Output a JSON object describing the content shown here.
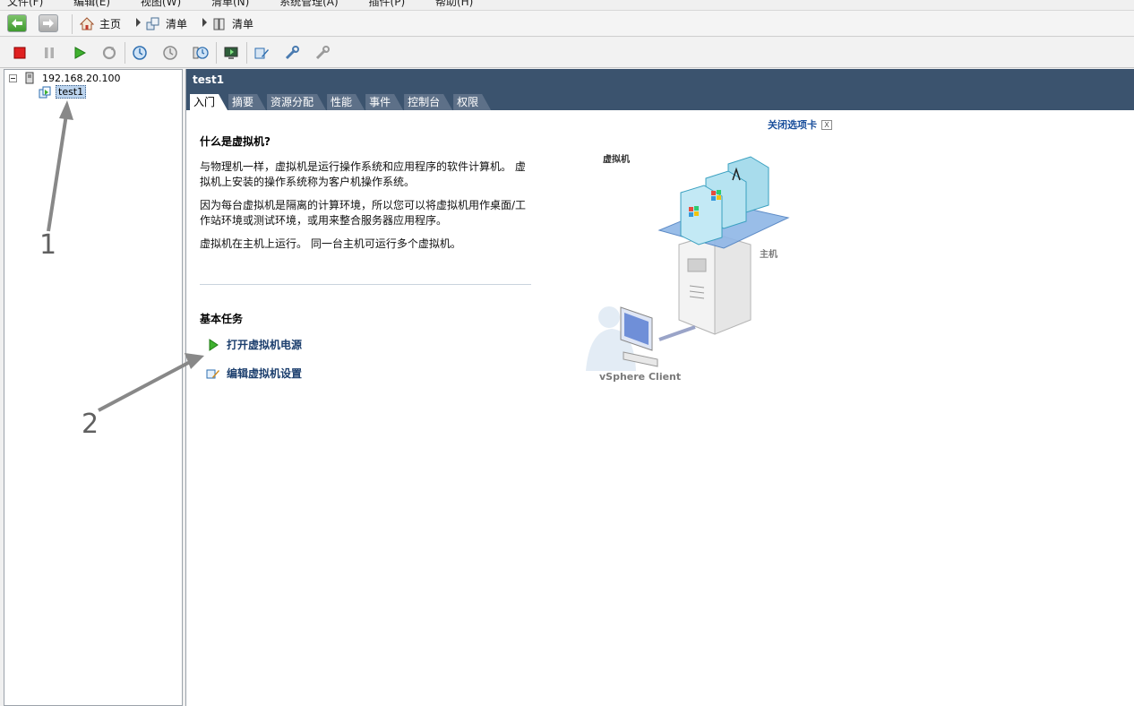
{
  "menubar": {
    "items": [
      "文件(F)",
      "编辑(E)",
      "视图(W)",
      "清单(N)",
      "系统管理(A)",
      "插件(P)",
      "帮助(H)"
    ]
  },
  "navbar": {
    "breadcrumbs": [
      "主页",
      "清单",
      "清单"
    ]
  },
  "toolbar": {
    "icons": [
      "stop-icon",
      "pause-icon",
      "play-icon",
      "reset-icon",
      "snapshot-icon",
      "revert-snapshot-icon",
      "snapshot-manager-icon",
      "console-icon",
      "edit-settings-icon",
      "tools-icon",
      "migrate-icon"
    ]
  },
  "tree": {
    "host": "192.168.20.100",
    "vm": "test1"
  },
  "main": {
    "title": "test1",
    "tabs": [
      "入门",
      "摘要",
      "资源分配",
      "性能",
      "事件",
      "控制台",
      "权限"
    ],
    "close_tab": "关闭选项卡",
    "close_x": "X",
    "heading": "什么是虚拟机?",
    "paragraphs": [
      "与物理机一样，虚拟机是运行操作系统和应用程序的软件计算机。 虚拟机上安装的操作系统称为客户机操作系统。",
      "因为每台虚拟机是隔离的计算环境，所以您可以将虚拟机用作桌面/工作站环境或测试环境，或用来整合服务器应用程序。",
      "虚拟机在主机上运行。 同一台主机可运行多个虚拟机。"
    ],
    "basic_tasks": "基本任务",
    "tasks": [
      "打开虚拟机电源",
      "编辑虚拟机设置"
    ]
  },
  "diagram": {
    "vm_label": "虚拟机",
    "host_label": "主机",
    "client_label": "vSphere Client"
  },
  "annotations": [
    "1",
    "2"
  ]
}
